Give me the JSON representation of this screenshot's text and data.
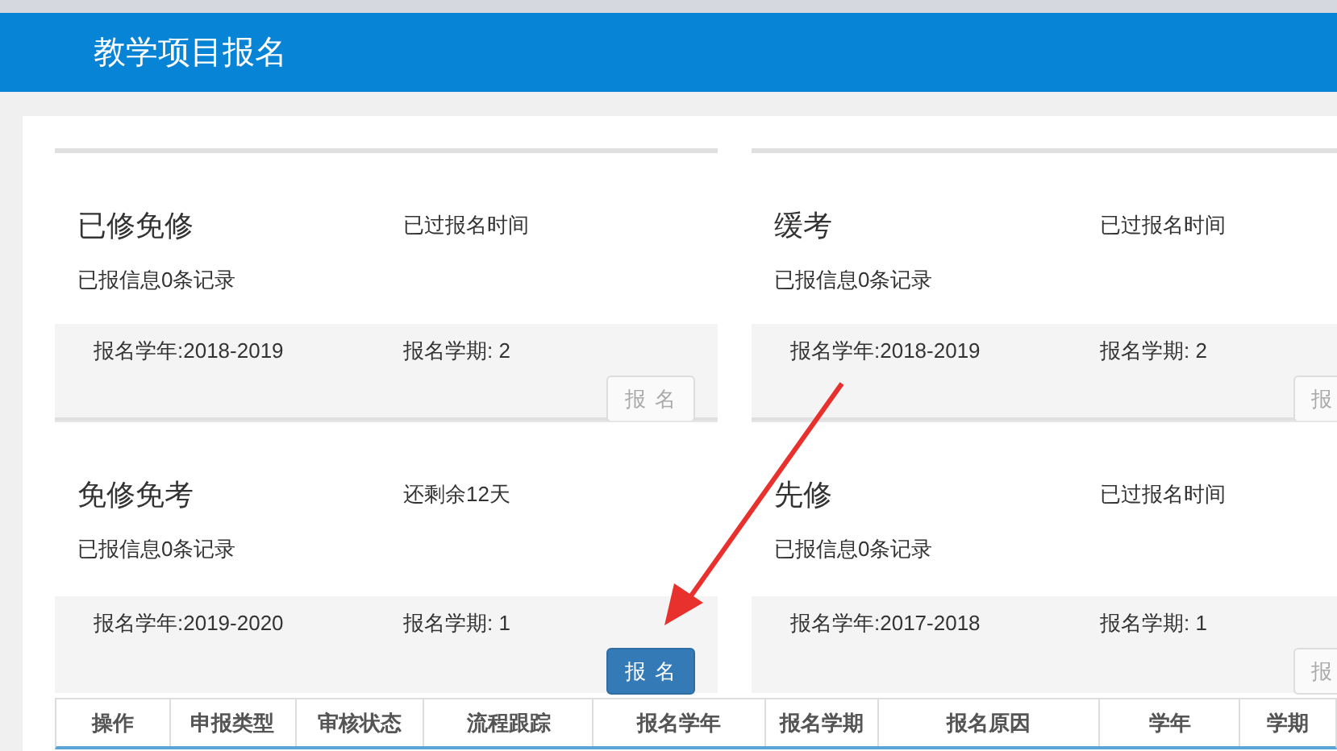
{
  "header": {
    "title": "教学项目报名"
  },
  "cards": [
    {
      "title": "已修免修",
      "status": "已过报名时间",
      "records": "已报信息0条记录",
      "year": "报名学年:2018-2019",
      "term": "报名学期: 2",
      "button": "报 名",
      "disabled": true
    },
    {
      "title": "缓考",
      "status": "已过报名时间",
      "records": "已报信息0条记录",
      "year": "报名学年:2018-2019",
      "term": "报名学期: 2",
      "button": "报",
      "disabled": true
    },
    {
      "title": "免修免考",
      "status": "还剩余12天",
      "records": "已报信息0条记录",
      "year": "报名学年:2019-2020",
      "term": "报名学期: 1",
      "button": "报 名",
      "disabled": false
    },
    {
      "title": "先修",
      "status": "已过报名时间",
      "records": "已报信息0条记录",
      "year": "报名学年:2017-2018",
      "term": "报名学期: 1",
      "button": "报",
      "disabled": true
    }
  ],
  "table": {
    "columns": [
      "操作",
      "申报类型",
      "审核状态",
      "流程跟踪",
      "报名学年",
      "报名学期",
      "报名原因",
      "学年",
      "学期"
    ]
  }
}
